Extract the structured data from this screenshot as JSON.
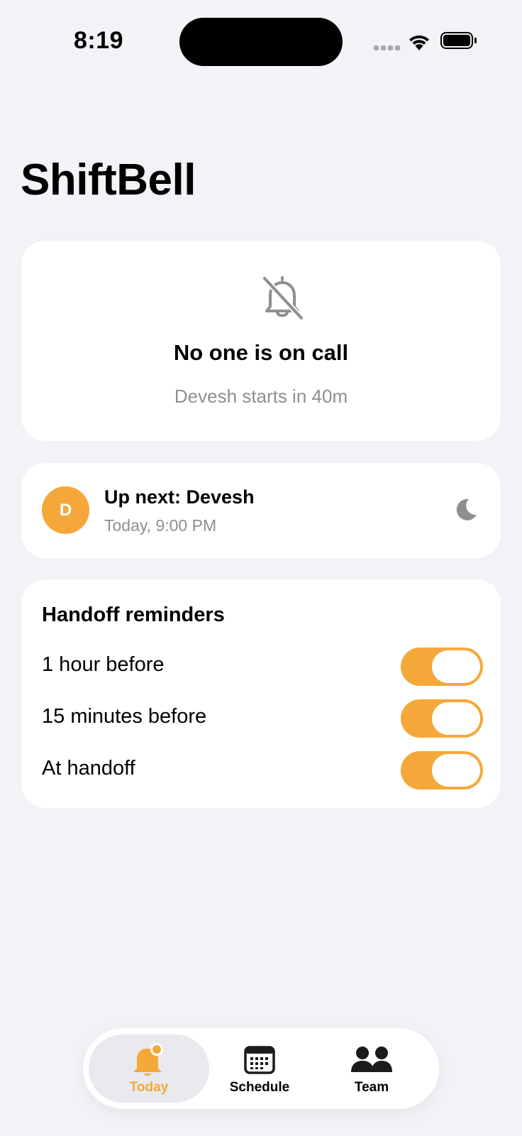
{
  "status_bar": {
    "time": "8:19"
  },
  "app": {
    "title": "ShiftBell",
    "accent_color": "#f4a83a"
  },
  "status_card": {
    "icon": "bell-slash-icon",
    "headline": "No one is on call",
    "subtitle": "Devesh starts in 40m"
  },
  "next_card": {
    "avatar_initial": "D",
    "title": "Up next: Devesh",
    "time": "Today, 9:00 PM",
    "icon": "moon-icon"
  },
  "reminders": {
    "title": "Handoff reminders",
    "items": [
      {
        "label": "1 hour before",
        "enabled": true
      },
      {
        "label": "15 minutes before",
        "enabled": true
      },
      {
        "label": "At handoff",
        "enabled": true
      }
    ]
  },
  "tab_bar": {
    "tabs": [
      {
        "label": "Today",
        "icon": "bell-badge-icon",
        "active": true
      },
      {
        "label": "Schedule",
        "icon": "calendar-icon",
        "active": false
      },
      {
        "label": "Team",
        "icon": "people-icon",
        "active": false
      }
    ]
  }
}
